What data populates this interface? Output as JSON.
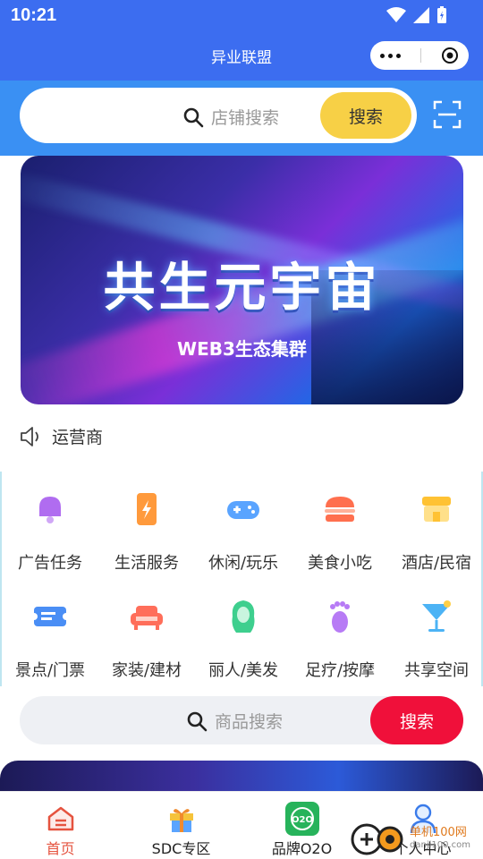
{
  "status_bar": {
    "time": "10:21"
  },
  "header": {
    "title": "异业联盟"
  },
  "search": {
    "placeholder": "店铺搜索",
    "button": "搜索"
  },
  "banner": {
    "title": "共生元宇宙",
    "subtitle": "WEB3生态集群"
  },
  "notice": {
    "text": "运营商"
  },
  "categories": [
    {
      "label": "广告任务",
      "icon": "bell-icon",
      "color": "#b06cf0"
    },
    {
      "label": "生活服务",
      "icon": "phone-icon",
      "color": "#ff9a3c"
    },
    {
      "label": "休闲/玩乐",
      "icon": "gamepad-icon",
      "color": "#5aa4ff"
    },
    {
      "label": "美食小吃",
      "icon": "burger-icon",
      "color": "#ff6f4e"
    },
    {
      "label": "酒店/民宿",
      "icon": "shop-icon",
      "color": "#ffc233"
    },
    {
      "label": "景点/门票",
      "icon": "ticket-icon",
      "color": "#4a8ef5"
    },
    {
      "label": "家装/建材",
      "icon": "sofa-icon",
      "color": "#ff6e5a"
    },
    {
      "label": "丽人/美发",
      "icon": "hair-icon",
      "color": "#3ecf8e"
    },
    {
      "label": "足疗/按摩",
      "icon": "foot-icon",
      "color": "#b77bf5"
    },
    {
      "label": "共享空间",
      "icon": "cocktail-icon",
      "color": "#4cb3f5"
    }
  ],
  "product_search": {
    "placeholder": "商品搜索",
    "button": "搜索"
  },
  "tabs": [
    {
      "label": "首页",
      "icon": "home-icon",
      "active": true
    },
    {
      "label": "SDC专区",
      "icon": "gift-icon",
      "active": false
    },
    {
      "label": "品牌O2O",
      "icon": "o2o-icon",
      "active": false
    },
    {
      "label": "个人中心",
      "icon": "user-icon",
      "active": false
    }
  ],
  "watermark": {
    "line1": "单机100网",
    "line2": "danji100.com"
  }
}
